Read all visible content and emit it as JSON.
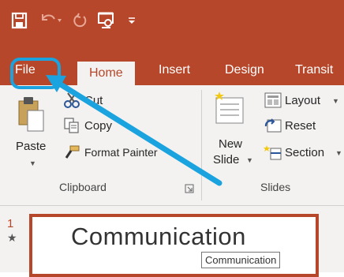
{
  "quick_access": {
    "save_icon": "save-icon",
    "undo_icon": "undo-icon",
    "redo_icon": "redo-icon",
    "present_icon": "present-icon",
    "customize_icon": "customize-icon"
  },
  "tabs": [
    {
      "label": "File"
    },
    {
      "label": "Home"
    },
    {
      "label": "Insert"
    },
    {
      "label": "Design"
    },
    {
      "label": "Transit"
    }
  ],
  "clipboard": {
    "paste_label": "Paste",
    "cut_label": "Cut",
    "copy_label": "Copy",
    "format_painter_label": "Format Painter",
    "group_label": "Clipboard"
  },
  "slides": {
    "new_slide_line1": "New",
    "new_slide_line2": "Slide",
    "layout_label": "Layout",
    "reset_label": "Reset",
    "section_label": "Section",
    "group_label": "Slides"
  },
  "slide_panel": {
    "slide_number": "1",
    "transition_marker": "★",
    "thumbnail_title": "Communication",
    "tooltip": "Communication"
  },
  "colors": {
    "brand": "#b7472a",
    "ribbon": "#f3f2f1",
    "callout": "#1aa3de"
  }
}
